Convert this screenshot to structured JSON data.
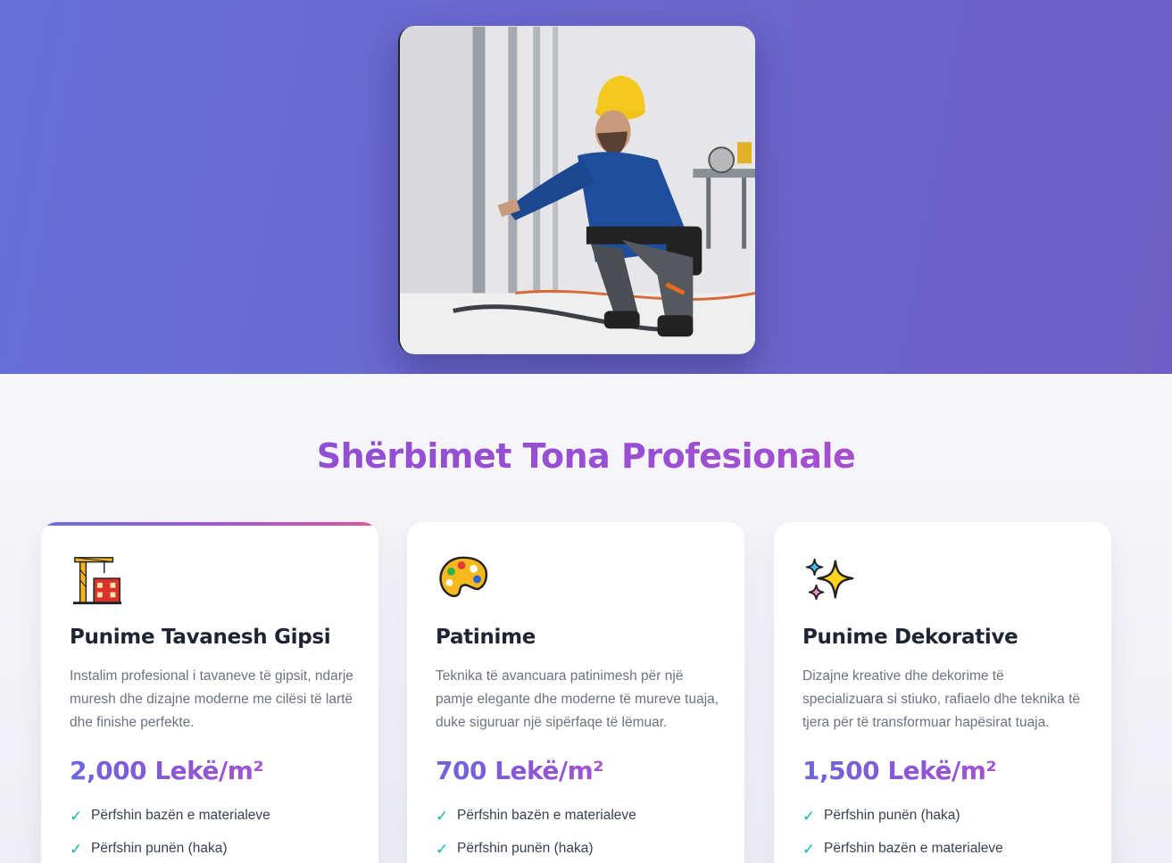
{
  "colors": {
    "hero_gradient": [
      "#6670d9",
      "#6f5fc4"
    ],
    "title_gradient": [
      "#8a4fd0",
      "#b650c6"
    ],
    "check": "#14b8a6",
    "accent_bar": [
      "#6a6ee0",
      "#e0559a"
    ]
  },
  "hero": {
    "image": "photo-worker-installing-drywall-profiles"
  },
  "services": {
    "title": "Shërbimet Tona Profesionale",
    "cards": [
      {
        "icon": "construction-crane-icon",
        "title": "Punime Tavanesh Gipsi",
        "description": "Instalim profesional i tavaneve të gipsit, ndarje muresh dhe dizajne moderne me cilësi të lartë dhe finishe perfekte.",
        "price": "2,000 Lekë/m²",
        "features": [
          "Përfshin bazën e materialeve",
          "Përfshin punën (haka)"
        ],
        "highlighted": true
      },
      {
        "icon": "artist-palette-icon",
        "title": "Patinime",
        "description": "Teknika të avancuara patinimesh për një pamje elegante dhe moderne të mureve tuaja, duke siguruar një sipërfaqe të lëmuar.",
        "price": "700 Lekë/m²",
        "features": [
          "Përfshin bazën e materialeve",
          "Përfshin punën (haka)"
        ],
        "highlighted": false
      },
      {
        "icon": "sparkles-icon",
        "title": "Punime Dekorative",
        "description": "Dizajne kreative dhe dekorime të specializuara si stiuko, rafiaelo dhe teknika të tjera për të transformuar hapësirat tuaja.",
        "price": "1,500 Lekë/m²",
        "features": [
          "Përfshin punën (haka)",
          "Përfshin bazën e materialeve"
        ],
        "highlighted": false
      }
    ]
  }
}
